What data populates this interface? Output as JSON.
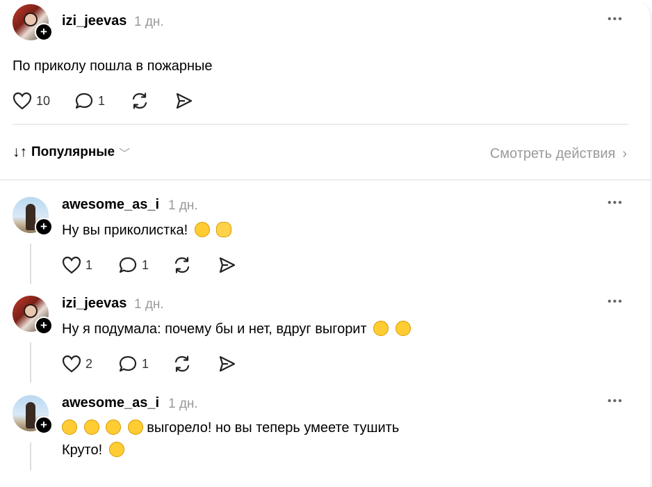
{
  "post": {
    "username": "izi_jeevas",
    "time": "1 дн.",
    "text": "По приколу пошла в пожарные",
    "likes": "10",
    "comments": "1"
  },
  "sort": {
    "label": "Популярные"
  },
  "view_activity": {
    "label": "Смотреть действия"
  },
  "replies": [
    {
      "username": "awesome_as_i",
      "time": "1 дн.",
      "text": "Ну вы приколистка!",
      "emojis": [
        "star-struck-emoji",
        "clapping-hands-emoji"
      ],
      "likes": "1",
      "comments": "1"
    },
    {
      "username": "izi_jeevas",
      "time": "1 дн.",
      "text": "Ну я подумала: почему бы и нет, вдруг выгорит",
      "emojis": [
        "smirking-face-emoji",
        "grinning-sweat-emoji"
      ],
      "likes": "2",
      "comments": "1"
    },
    {
      "username": "awesome_as_i",
      "time": "1 дн.",
      "text_after_emojis": "выгорело! но вы теперь умеете тушить",
      "emojis_before": [
        "tears-of-joy-emoji",
        "tears-of-joy-emoji",
        "tears-of-joy-emoji",
        "tears-of-joy-emoji"
      ],
      "line2": "Круто!",
      "line2_emoji": "sunglasses-emoji"
    }
  ]
}
